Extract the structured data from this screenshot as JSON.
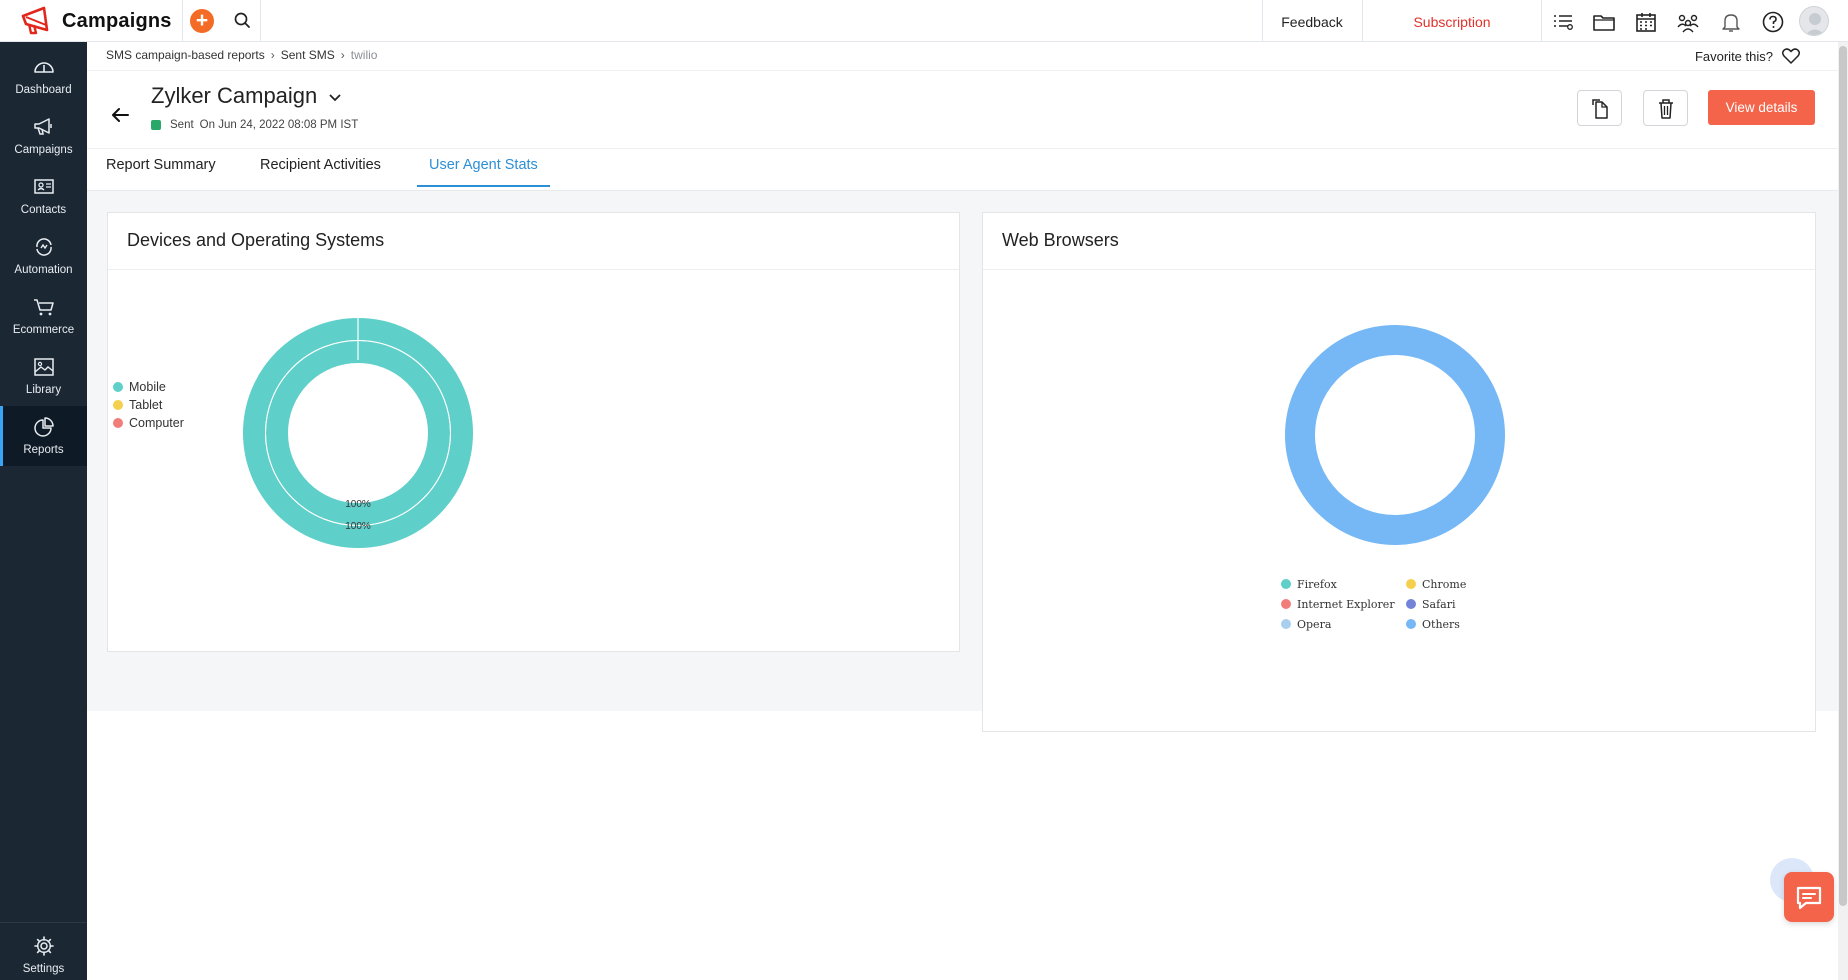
{
  "app": {
    "brand": "Campaigns",
    "accent": "#f36b24",
    "sidebar_bg": "#1b2733"
  },
  "topbar": {
    "feedback": "Feedback",
    "subscription": "Subscription",
    "icons": [
      "add-icon",
      "search-icon",
      "list-icon",
      "folder-icon",
      "calendar-icon",
      "team-icon",
      "bell-icon",
      "help-icon",
      "avatar"
    ]
  },
  "sidebar": {
    "items": [
      {
        "label": "Dashboard",
        "icon": "gauge-icon"
      },
      {
        "label": "Campaigns",
        "icon": "megaphone-icon"
      },
      {
        "label": "Contacts",
        "icon": "contact-card-icon"
      },
      {
        "label": "Automation",
        "icon": "automation-icon"
      },
      {
        "label": "Ecommerce",
        "icon": "cart-icon"
      },
      {
        "label": "Library",
        "icon": "image-icon"
      },
      {
        "label": "Reports",
        "icon": "pie-chart-icon",
        "active": true
      }
    ],
    "settings": "Settings"
  },
  "breadcrumb": {
    "items": [
      "SMS campaign-based reports",
      "Sent SMS",
      "twilio"
    ]
  },
  "favorite": "Favorite this?",
  "campaign": {
    "title": "Zylker Campaign",
    "status": "Sent",
    "sent_on": "On Jun 24, 2022 08:08 PM IST",
    "status_color": "#29a86a"
  },
  "actions": {
    "view_details": "View details"
  },
  "tabs": [
    "Report Summary",
    "Recipient Activities",
    "User Agent Stats"
  ],
  "active_tab": "User Agent Stats",
  "devices_panel": {
    "title": "Devices and Operating Systems",
    "legend": [
      {
        "label": "Mobile",
        "color": "#5fcfc9"
      },
      {
        "label": "Tablet",
        "color": "#f5d04e"
      },
      {
        "label": "Computer",
        "color": "#f07d7a"
      }
    ],
    "inner_label": "100%",
    "outer_label": "100%"
  },
  "browsers_panel": {
    "title": "Web Browsers",
    "legend": [
      {
        "label": "Firefox",
        "color": "#5fcfc9"
      },
      {
        "label": "Chrome",
        "color": "#f5d04e"
      },
      {
        "label": "Internet Explorer",
        "color": "#f07d7a"
      },
      {
        "label": "Safari",
        "color": "#7283d8"
      },
      {
        "label": "Opera",
        "color": "#a8cfee"
      },
      {
        "label": "Others",
        "color": "#76b8f5"
      }
    ]
  },
  "chart_data": [
    {
      "type": "pie",
      "title": "Devices and Operating Systems",
      "series": [
        {
          "name": "Devices",
          "categories": [
            "Mobile",
            "Tablet",
            "Computer"
          ],
          "values": [
            100,
            0,
            0
          ]
        },
        {
          "name": "Operating Systems",
          "categories": [
            "Mobile",
            "Tablet",
            "Computer"
          ],
          "values": [
            100,
            0,
            0
          ]
        }
      ],
      "legend": "left"
    },
    {
      "type": "pie",
      "title": "Web Browsers",
      "categories": [
        "Firefox",
        "Chrome",
        "Internet Explorer",
        "Safari",
        "Opera",
        "Others"
      ],
      "values": [
        0,
        0,
        0,
        0,
        0,
        100
      ],
      "legend": "bottom"
    }
  ]
}
